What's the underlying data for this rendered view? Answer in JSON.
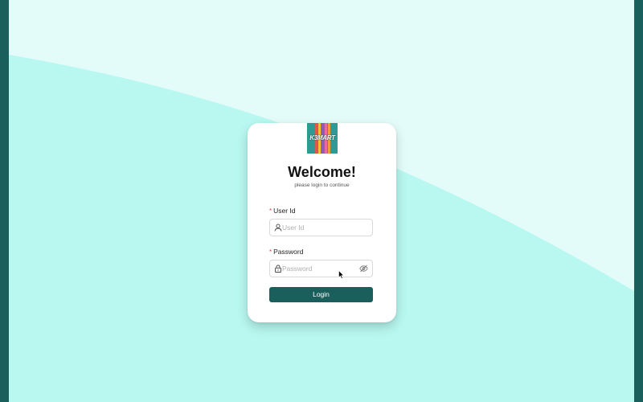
{
  "colors": {
    "frame": "#1b5f5c",
    "background": "#e3fcf9",
    "wave": "#b8f8f0",
    "primary": "#1b5f5c",
    "required_marker": "#e0463c"
  },
  "logo": {
    "text": "K3MART",
    "icon": "k3mart-logo"
  },
  "login_card": {
    "title": "Welcome!",
    "subtitle": "please login to continue",
    "user_id": {
      "required_marker": "*",
      "label": "User Id",
      "placeholder": "User Id",
      "value": "",
      "icon": "user-icon"
    },
    "password": {
      "required_marker": "*",
      "label": "Password",
      "placeholder": "Password",
      "value": "",
      "icon": "lock-icon",
      "toggle_icon": "eye-slash-icon"
    },
    "login_button": "Login"
  }
}
